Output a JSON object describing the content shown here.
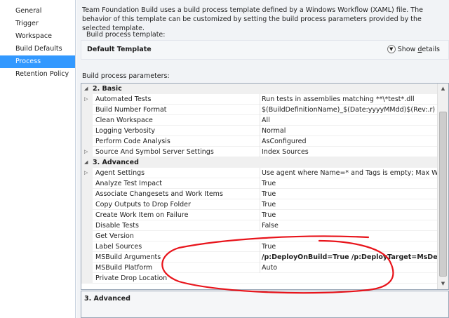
{
  "nav": {
    "items": [
      {
        "label": "General",
        "selected": false
      },
      {
        "label": "Trigger",
        "selected": false
      },
      {
        "label": "Workspace",
        "selected": false
      },
      {
        "label": "Build Defaults",
        "selected": false
      },
      {
        "label": "Process",
        "selected": true
      },
      {
        "label": "Retention Policy",
        "selected": false
      }
    ]
  },
  "header": {
    "description": "Team Foundation Build uses a build process template defined by a Windows Workflow (XAML) file. The behavior of this template can be customized by setting the build process parameters provided by the selected template."
  },
  "template": {
    "label": "Build process template:",
    "name": "Default Template",
    "show_details_prefix": "Show ",
    "show_details_underlined": "d",
    "show_details_suffix": "etails"
  },
  "params": {
    "label": "Build process parameters:",
    "rows": [
      {
        "type": "category",
        "name": "2. Basic"
      },
      {
        "type": "prop",
        "name": "Automated Tests",
        "value": "Run tests in assemblies matching **\\*test*.dll",
        "expandable": true
      },
      {
        "type": "prop",
        "name": "Build Number Format",
        "value": "$(BuildDefinitionName)_$(Date:yyyyMMdd)$(Rev:.r)"
      },
      {
        "type": "prop",
        "name": "Clean Workspace",
        "value": "All"
      },
      {
        "type": "prop",
        "name": "Logging Verbosity",
        "value": "Normal"
      },
      {
        "type": "prop",
        "name": "Perform Code Analysis",
        "value": "AsConfigured"
      },
      {
        "type": "prop",
        "name": "Source And Symbol Server Settings",
        "value": "Index Sources",
        "expandable": true
      },
      {
        "type": "category",
        "name": "3. Advanced"
      },
      {
        "type": "prop",
        "name": "Agent Settings",
        "value": "Use agent where Name=* and Tags is empty; Max Wait Time",
        "expandable": true
      },
      {
        "type": "prop",
        "name": "Analyze Test Impact",
        "value": "True"
      },
      {
        "type": "prop",
        "name": "Associate Changesets and Work Items",
        "value": "True"
      },
      {
        "type": "prop",
        "name": "Copy Outputs to Drop Folder",
        "value": "True"
      },
      {
        "type": "prop",
        "name": "Create Work Item on Failure",
        "value": "True"
      },
      {
        "type": "prop",
        "name": "Disable Tests",
        "value": "False"
      },
      {
        "type": "prop",
        "name": "Get Version",
        "value": ""
      },
      {
        "type": "prop",
        "name": "Label Sources",
        "value": "True"
      },
      {
        "type": "prop",
        "name": "MSBuild Arguments",
        "value": "/p:DeployOnBuild=True /p:DeployTarget=MsDeployPubli",
        "bold": true
      },
      {
        "type": "prop",
        "name": "MSBuild Platform",
        "value": "Auto"
      },
      {
        "type": "prop",
        "name": "Private Drop Location",
        "value": ""
      }
    ]
  },
  "description_pane": {
    "title": "3. Advanced"
  },
  "colors": {
    "selection": "#3399ff",
    "annotation": "#e8141b"
  },
  "icons": {
    "expander": "triangle-right-icon",
    "collapser": "triangle-down-icon",
    "show_details": "chevron-down-circle-icon"
  }
}
